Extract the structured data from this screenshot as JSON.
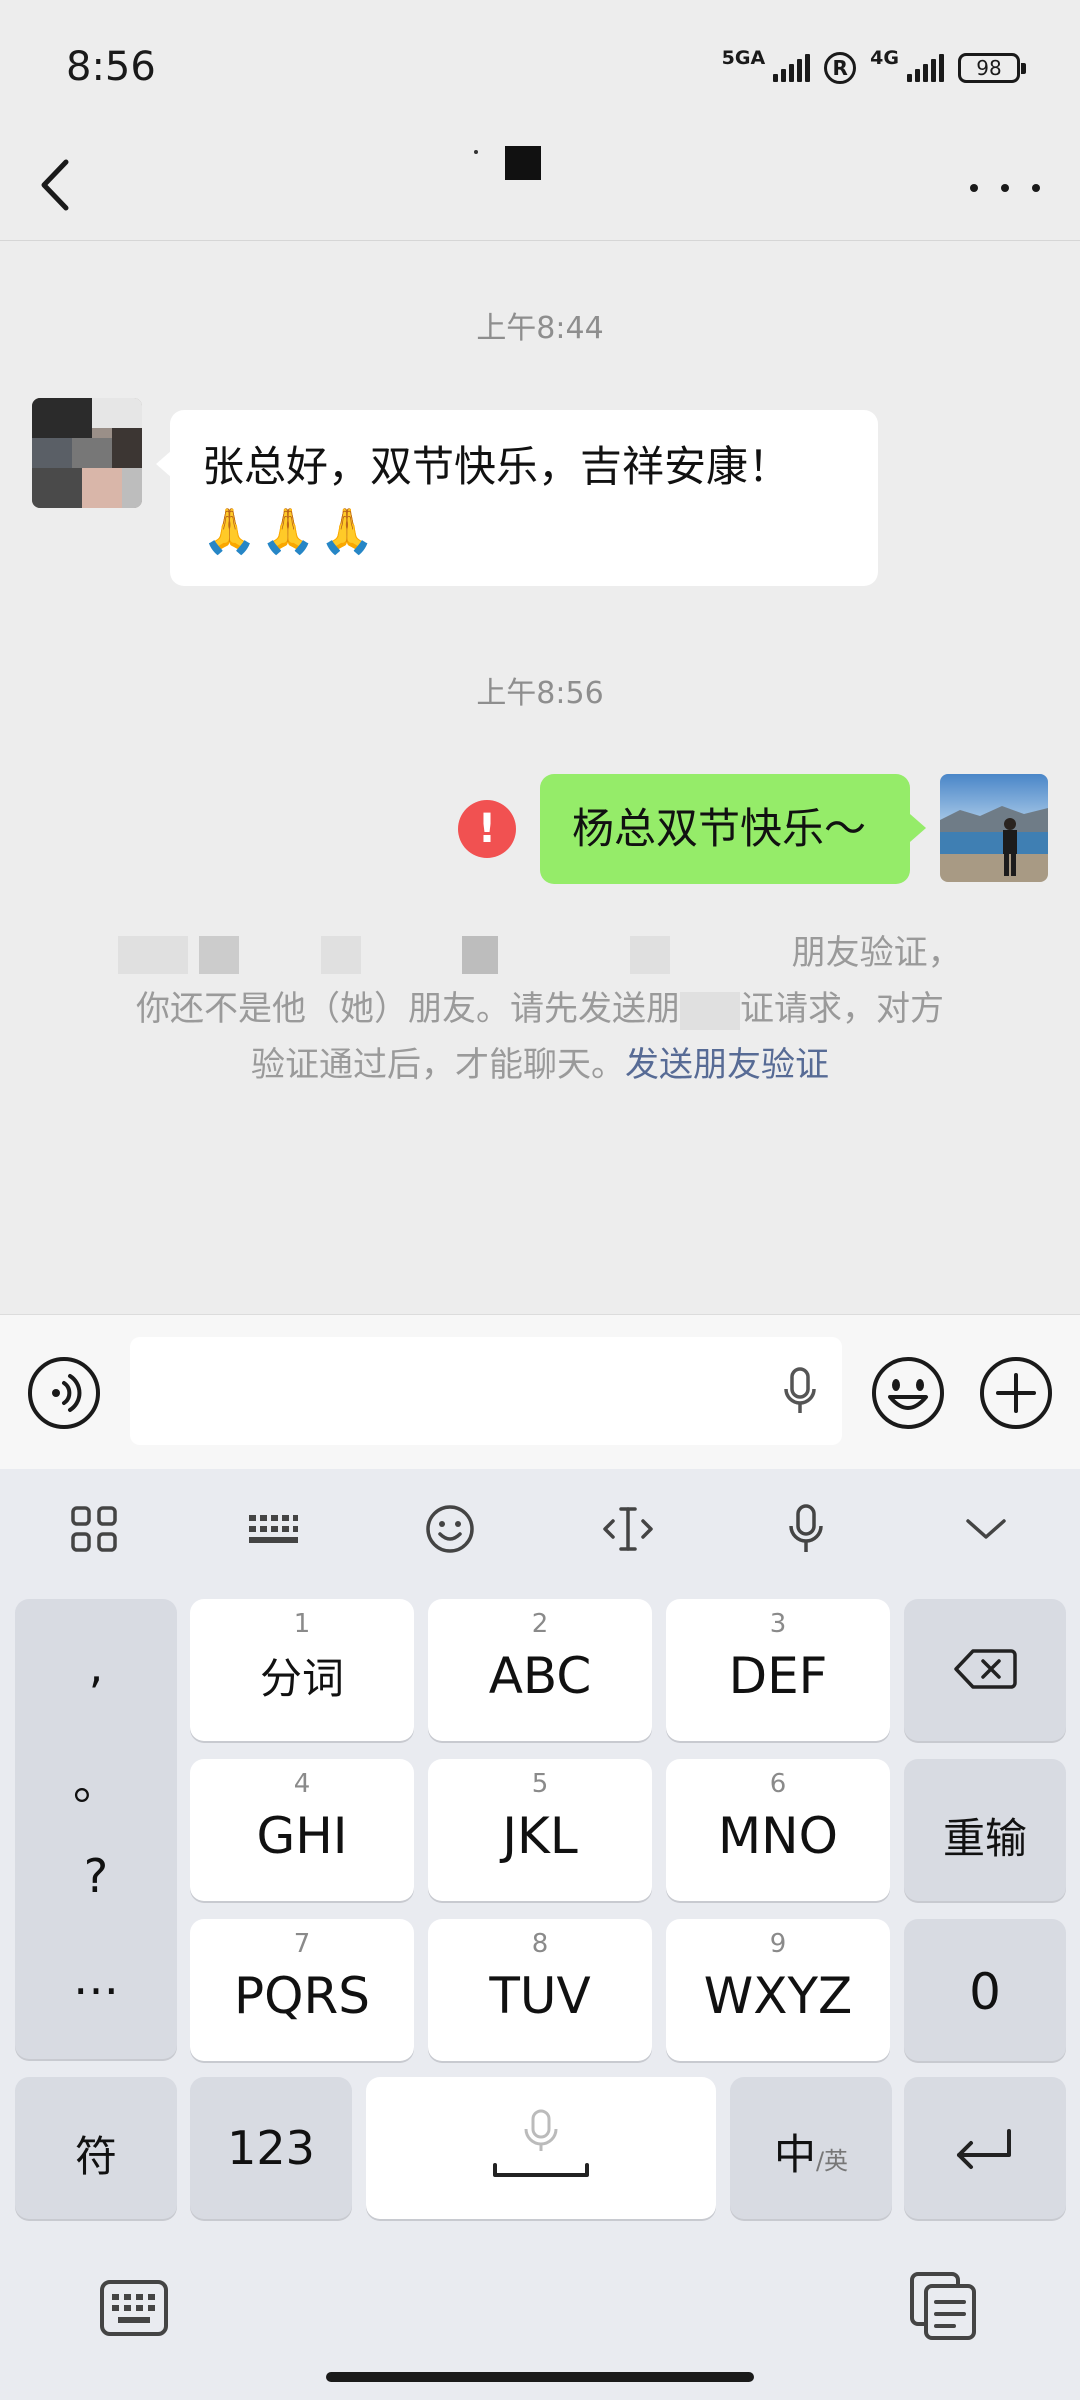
{
  "status_bar": {
    "time": "8:56",
    "signal1_label": "5GA",
    "roaming_label": "R",
    "signal2_label": "4G",
    "battery": "98"
  },
  "nav": {
    "title": ""
  },
  "messages": [
    {
      "type": "timestamp",
      "text": "上午8:44"
    },
    {
      "type": "incoming",
      "text": "张总好，双节快乐，吉祥安康！",
      "emoji": "🙏🙏🙏"
    },
    {
      "type": "timestamp",
      "text": "上午8:56"
    },
    {
      "type": "outgoing",
      "text": "杨总双节快乐～",
      "status": "failed"
    }
  ],
  "system_notice": {
    "line1_tail": "朋友验证，",
    "line2_head": "你还不是他（她）朋友。请先发送朋",
    "line2_tail": "证请求，对方",
    "line3_text": "验证通过后，才能聊天。",
    "link": "发送朋友验证"
  },
  "keyboard": {
    "punct": [
      ",",
      "。",
      "?",
      "…"
    ],
    "keys": [
      {
        "num": "1",
        "label": "分词"
      },
      {
        "num": "2",
        "label": "ABC"
      },
      {
        "num": "3",
        "label": "DEF"
      },
      {
        "num": "4",
        "label": "GHI"
      },
      {
        "num": "5",
        "label": "JKL"
      },
      {
        "num": "6",
        "label": "MNO"
      },
      {
        "num": "7",
        "label": "PQRS"
      },
      {
        "num": "8",
        "label": "TUV"
      },
      {
        "num": "9",
        "label": "WXYZ"
      }
    ],
    "reinput": "重输",
    "zero": "0",
    "symbols": "符",
    "numbers": "123",
    "lang_main": "中",
    "lang_sub": "/英"
  },
  "colors": {
    "accent_green": "#95ec69",
    "error_red": "#f15151",
    "link_blue": "#576b95"
  }
}
